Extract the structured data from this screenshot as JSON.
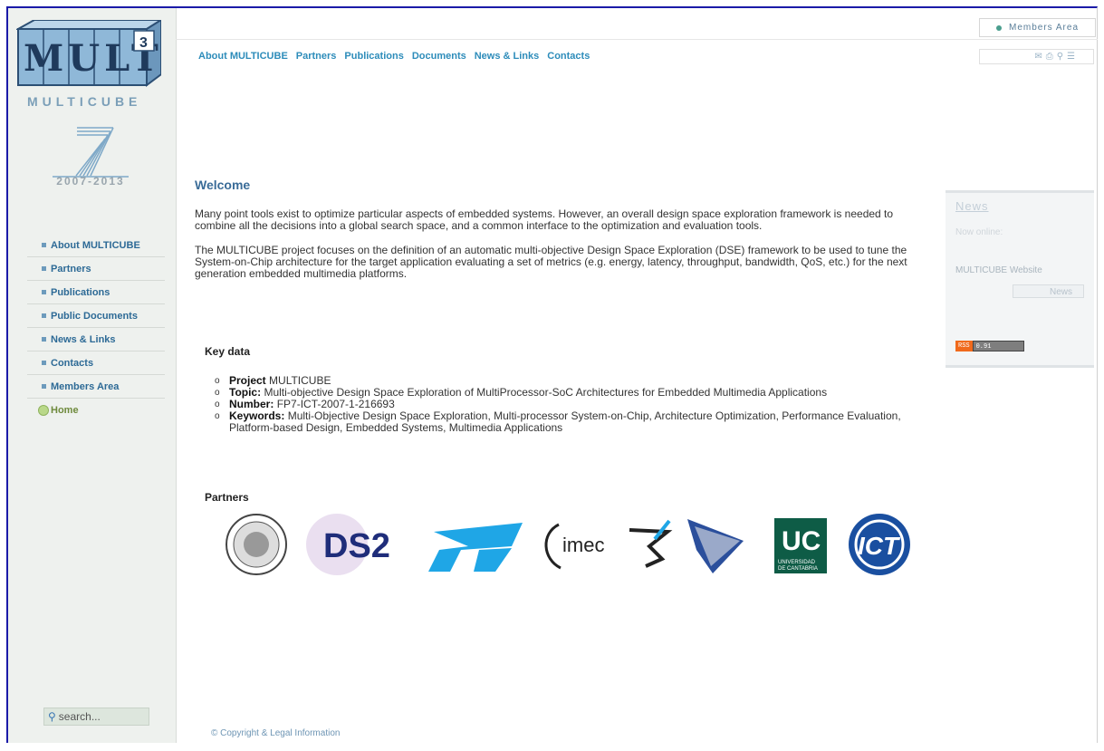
{
  "top": {
    "members_area": "Members Area",
    "tool_icons": [
      "mail-icon",
      "print-icon",
      "search-icon",
      "sitemap-icon"
    ],
    "nav": [
      "About MULTICUBE",
      "Partners",
      "Publications",
      "Documents",
      "News & Links",
      "Contacts"
    ]
  },
  "sidebar": {
    "logo_letters": "MULTI",
    "logo_superscript": "3",
    "logo_caption": "MULTICUBE",
    "fp7_years": "2007-2013",
    "items": [
      {
        "label": "About MULTICUBE"
      },
      {
        "label": "Partners"
      },
      {
        "label": "Publications"
      },
      {
        "label": "Public Documents"
      },
      {
        "label": "News & Links"
      },
      {
        "label": "Contacts"
      },
      {
        "label": "Members Area"
      },
      {
        "label": "Home"
      }
    ],
    "search_placeholder": "search..."
  },
  "main": {
    "welcome": "Welcome",
    "para1": "Many point tools exist to optimize particular aspects of embedded systems. However, an overall design space exploration framework is needed to combine all the decisions into a global search space, and a common interface to the optimization and evaluation tools.",
    "para2": "The MULTICUBE project focuses on the definition of an automatic multi-objective Design Space Exploration (DSE) framework to be used to tune the System-on-Chip architecture for the target application evaluating a set of metrics (e.g. energy, latency, throughput, bandwidth, QoS, etc.) for the next generation embedded multimedia platforms.",
    "key_data_title": "Key data",
    "key_data": [
      {
        "label": "Project",
        "value": "MULTICUBE"
      },
      {
        "label": "Topic:",
        "value": "Multi-objective Design Space Exploration of MultiProcessor-SoC Architectures for Embedded Multimedia Applications"
      },
      {
        "label": "Number:",
        "value": "FP7-ICT-2007-1-216693"
      },
      {
        "label": "Keywords:",
        "value": "Multi-Objective Design Space Exploration, Multi-processor System-on-Chip, Architecture Optimization, Performance Evaluation, Platform-based Design, Embedded Systems, Multimedia Applications"
      }
    ],
    "partners_title": "Partners",
    "partner_logos": {
      "ds2": "DS2",
      "imec": "imec",
      "uc": "UC",
      "uc_caption_1": "UNIVERSIDAD",
      "uc_caption_2": "DE CANTABRIA",
      "ict": "ICT"
    },
    "copyright": "© Copyright & Legal Information"
  },
  "news": {
    "title": "News",
    "online": "Now online:",
    "site": "MULTICUBE Website",
    "button": "News",
    "rss_a": "RSS",
    "rss_b": "0.91"
  },
  "colors": {
    "accent": "#2d8cba",
    "sidebar_bg": "#eef1ee",
    "frame": "#1a1aa8"
  }
}
